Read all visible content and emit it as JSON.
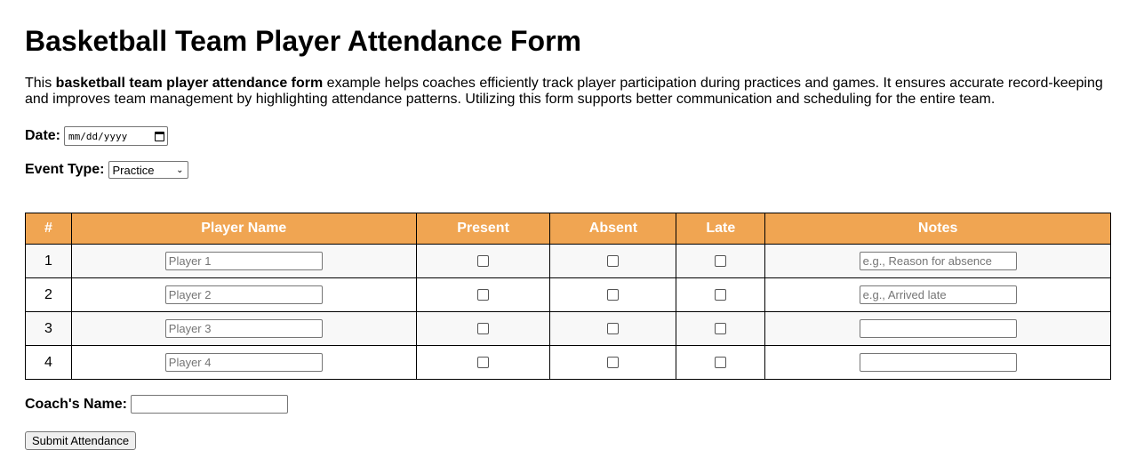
{
  "page": {
    "title": "Basketball Team Player Attendance Form",
    "intro": {
      "prefix": "This ",
      "bold": "basketball team player attendance form",
      "suffix": " example helps coaches efficiently track player participation during practices and games. It ensures accurate record-keeping and improves team management by highlighting attendance patterns. Utilizing this form supports better communication and scheduling for the entire team."
    }
  },
  "form": {
    "date_label": "Date:",
    "date_placeholder": "mm/dd/yyyy",
    "event_label": "Event Type:",
    "event_value": "Practice",
    "coach_label": "Coach's Name:",
    "coach_value": "",
    "submit_label": "Submit Attendance"
  },
  "table": {
    "headers": [
      "#",
      "Player Name",
      "Present",
      "Absent",
      "Late",
      "Notes"
    ],
    "rows": [
      {
        "num": "1",
        "player_placeholder": "Player 1",
        "present": false,
        "absent": false,
        "late": false,
        "notes_placeholder": "e.g., Reason for absence"
      },
      {
        "num": "2",
        "player_placeholder": "Player 2",
        "present": false,
        "absent": false,
        "late": false,
        "notes_placeholder": "e.g., Arrived late"
      },
      {
        "num": "3",
        "player_placeholder": "Player 3",
        "present": false,
        "absent": false,
        "late": false,
        "notes_placeholder": ""
      },
      {
        "num": "4",
        "player_placeholder": "Player 4",
        "present": false,
        "absent": false,
        "late": false,
        "notes_placeholder": ""
      }
    ]
  },
  "colors": {
    "header_bg": "#f0a552",
    "header_text": "#ffffff",
    "odd_row_bg": "#f8f8f8"
  },
  "icons": {
    "date_picker": "calendar-icon",
    "select_arrow": "chevron-down-icon"
  }
}
